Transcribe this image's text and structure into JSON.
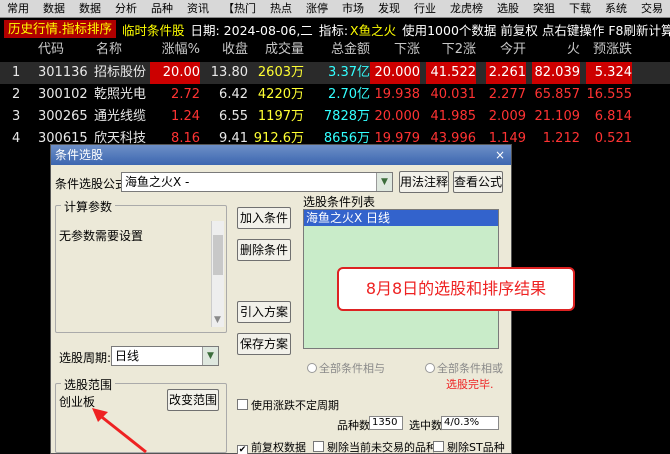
{
  "menu": [
    "常用",
    "数据",
    "数据",
    "分析",
    "品种",
    "资讯",
    "【热门",
    "热点",
    "涨停",
    "市场",
    "发现",
    "行业",
    "龙虎榜",
    "选股",
    "突狙",
    "下载",
    "系统",
    "交易"
  ],
  "infobar": {
    "badge": "历史行情.指标排序",
    "mode": "临时条件股",
    "date": "日期: 2024-08-06,二",
    "indicator_label": "指标:",
    "indicator": "X鱼之火",
    "note": "使用1000个数据 前复权 点右键操作 F8刷新计算"
  },
  "table": {
    "columns": [
      "代码",
      "名称",
      "涨幅%",
      "收盘",
      "成交量",
      "总金额",
      "下涨",
      "下2涨",
      "今开",
      "火",
      "预涨跌"
    ],
    "rows": [
      {
        "idx": "1",
        "code": "301136",
        "name": "招标股份",
        "chg": "20.00",
        "close": "13.80",
        "vol": "2603万",
        "amt": "3.37亿",
        "d1": "20.000",
        "d2": "41.522",
        "open": "2.261",
        "fire": "82.039",
        "pred": "5.324"
      },
      {
        "idx": "2",
        "code": "300102",
        "name": "乾照光电",
        "chg": "2.72",
        "close": "6.42",
        "vol": "4220万",
        "amt": "2.70亿",
        "d1": "19.938",
        "d2": "40.031",
        "open": "2.277",
        "fire": "65.857",
        "pred": "16.555"
      },
      {
        "idx": "3",
        "code": "300265",
        "name": "通光线缆",
        "chg": "1.24",
        "close": "6.55",
        "vol": "1197万",
        "amt": "7828万",
        "d1": "20.000",
        "d2": "41.985",
        "open": "2.009",
        "fire": "21.109",
        "pred": "6.814"
      },
      {
        "idx": "4",
        "code": "300615",
        "name": "欣天科技",
        "chg": "8.16",
        "close": "9.41",
        "vol": "912.6万",
        "amt": "8656万",
        "d1": "19.979",
        "d2": "43.996",
        "open": "1.149",
        "fire": "1.212",
        "pred": "0.521"
      }
    ]
  },
  "dialog": {
    "title": "条件选股",
    "close": "×",
    "formula_label": "条件选股公式",
    "formula_value": "海鱼之火X    -",
    "usage_btn": "用法注释",
    "view_btn": "查看公式",
    "params_group": "计算参数",
    "params_text": "无参数需要设置",
    "add_btn": "加入条件",
    "del_btn": "删除条件",
    "import_btn": "引入方案",
    "save_btn": "保存方案",
    "cond_list_label": "选股条件列表",
    "cond_item": "海鱼之火X  日线",
    "period_label": "选股周期:",
    "period_value": "日线",
    "radio_and": "全部条件相与",
    "radio_or": "全部条件相或",
    "finish": "选股完毕.",
    "range_group": "选股范围",
    "range_value": "创业板",
    "change_range_btn": "改变范围",
    "use_period_chk": "使用涨跌不定周期",
    "count_label": "品种数",
    "count_value": "1350",
    "selected_label": "选中数",
    "selected_value": "4/0.3%",
    "fq_chk": "前复权数据",
    "excl_chk": "剔除当前未交易的品种",
    "st_chk": "剔除ST品种"
  },
  "annotation": "8月8日的选股和排序结果",
  "colors": {
    "accent_red": "#cc0000",
    "yellow": "#ffff33",
    "cyan": "#33ffff",
    "dialog_bg": "#ece9d8"
  }
}
